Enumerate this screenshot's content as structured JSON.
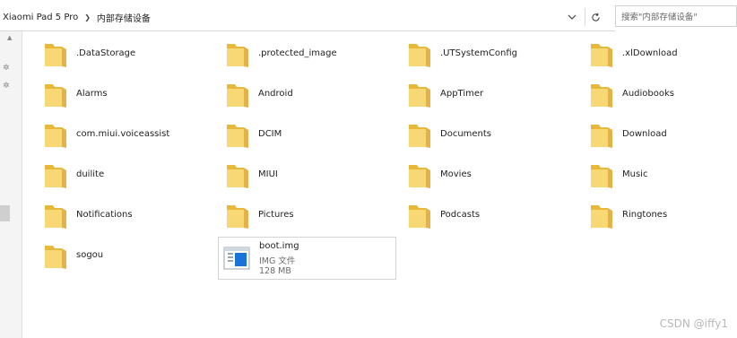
{
  "breadcrumb": [
    "Xiaomi Pad 5 Pro",
    "内部存储设备"
  ],
  "search": {
    "placeholder": "搜索\"内部存储设备\""
  },
  "folders": [
    ".DataStorage",
    ".protected_image",
    ".UTSystemConfig",
    ".xlDownload",
    "Alarms",
    "Android",
    "AppTimer",
    "Audiobooks",
    "com.miui.voiceassist",
    "DCIM",
    "Documents",
    "Download",
    "duilite",
    "MIUI",
    "Movies",
    "Music",
    "Notifications",
    "Pictures",
    "Podcasts",
    "Ringtones",
    "sogou"
  ],
  "file": {
    "name": "boot.img",
    "type": "IMG 文件",
    "size": "128 MB"
  },
  "watermark": "CSDN @iffy1",
  "colors": {
    "folder_back": "#e8b83a",
    "folder_front": "#f8d775",
    "file_blue": "#1a73d9"
  }
}
